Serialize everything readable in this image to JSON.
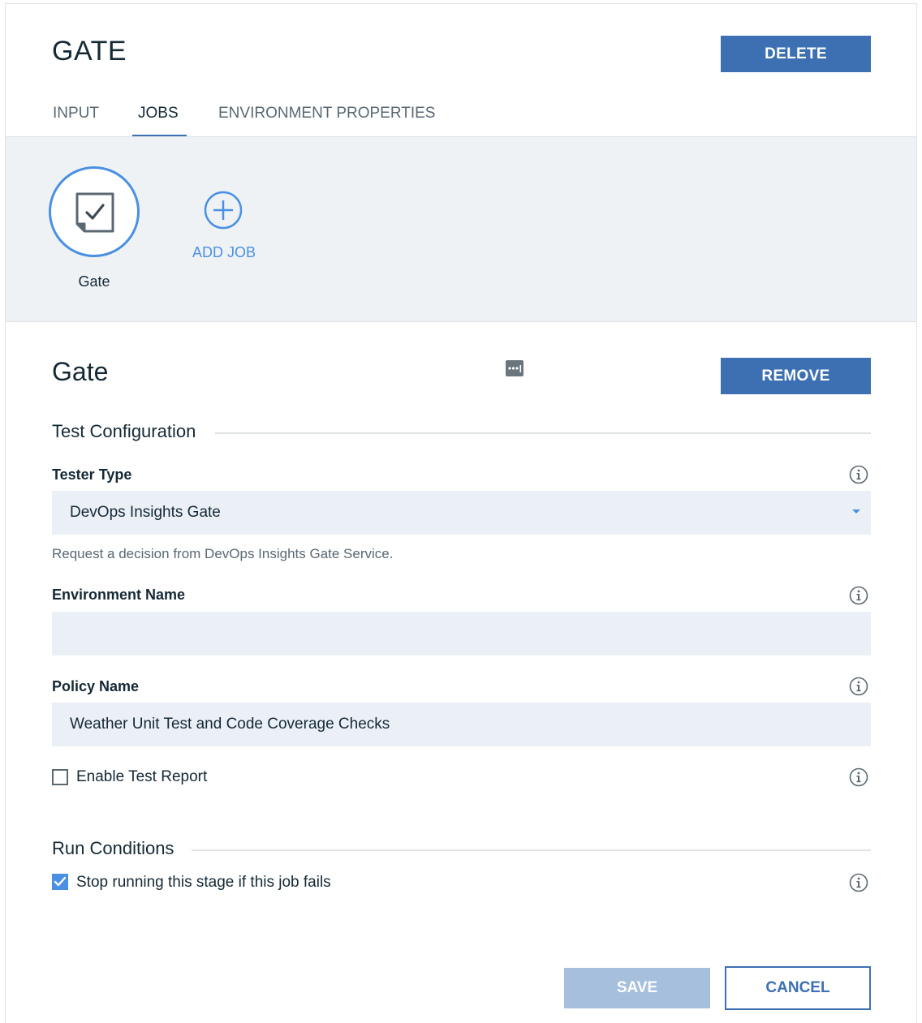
{
  "header": {
    "title": "GATE",
    "delete_label": "DELETE",
    "tabs": [
      {
        "label": "INPUT",
        "active": false
      },
      {
        "label": "JOBS",
        "active": true
      },
      {
        "label": "ENVIRONMENT PROPERTIES",
        "active": false
      }
    ]
  },
  "jobs": {
    "items": [
      {
        "label": "Gate",
        "icon": "gate-job-icon",
        "selected": true
      }
    ],
    "add_label": "ADD JOB"
  },
  "detail": {
    "title": "Gate",
    "remove_label": "REMOVE",
    "test_configuration": {
      "section_title": "Test Configuration",
      "tester_type": {
        "label": "Tester Type",
        "value": "DevOps Insights Gate",
        "helper": "Request a decision from DevOps Insights Gate Service."
      },
      "environment_name": {
        "label": "Environment Name",
        "value": ""
      },
      "policy_name": {
        "label": "Policy Name",
        "value": "Weather Unit Test and Code Coverage Checks"
      },
      "enable_test_report": {
        "label": "Enable Test Report",
        "checked": false
      }
    },
    "run_conditions": {
      "section_title": "Run Conditions",
      "stop_on_fail": {
        "label": "Stop running this stage if this job fails",
        "checked": true
      }
    }
  },
  "footer": {
    "save_label": "SAVE",
    "save_enabled": false,
    "cancel_label": "CANCEL"
  },
  "colors": {
    "primary": "#3d70b2",
    "accent": "#4a90e2",
    "field_bg": "#ebf0f7",
    "band_bg": "#eff2f5",
    "disabled": "#a5bfdd"
  }
}
